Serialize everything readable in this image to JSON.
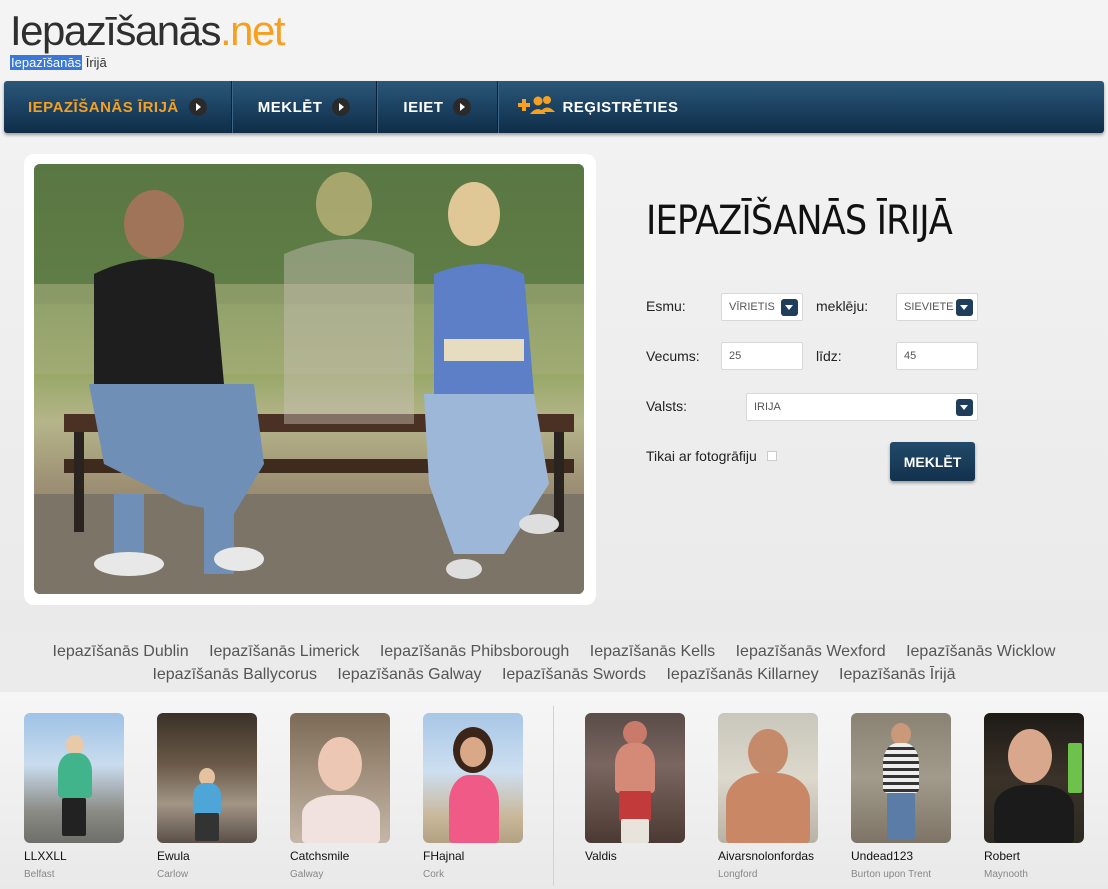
{
  "header": {
    "logo_brand": "Iepazīšanās",
    "logo_tld": ".net",
    "breadcrumb_selected": "Iepazīšanās",
    "breadcrumb_rest": " Īrijā"
  },
  "nav": {
    "items": [
      {
        "label": "IEPAZĪŠANĀS ĪRIJĀ",
        "icon": "chevron-right-icon"
      },
      {
        "label": "MEKLĒT",
        "icon": "chevron-right-icon"
      },
      {
        "label": "IEIET",
        "icon": "chevron-right-icon"
      },
      {
        "label": "REĢISTRĒTIES",
        "icon": "add-user-icon"
      }
    ],
    "accent": "#f5a021"
  },
  "search": {
    "title": "IEPAZĪŠANĀS ĪRIJĀ",
    "i_am_label": "Esmu:",
    "i_am_value": "VĪRIETIS",
    "seeking_label": "meklēju:",
    "seeking_value": "SIEVIETE",
    "age_label": "Vecums:",
    "age_from": "25",
    "to_label": "līdz:",
    "age_to": "45",
    "country_label": "Valsts:",
    "country_value": "IRIJA",
    "photo_only_label": "Tikai ar fotogrāfiju",
    "submit_label": "MEKLĒT",
    "button_color": "#12314d"
  },
  "city_links": {
    "row1": [
      "Iepazīšanās Dublin",
      "Iepazīšanās Limerick",
      "Iepazīšanās Phibsborough",
      "Iepazīšanās Kells",
      "Iepazīšanās Wexford",
      "Iepazīšanās Wicklow"
    ],
    "row2": [
      "Iepazīšanās Ballycorus",
      "Iepazīšanās Galway",
      "Iepazīšanās Swords",
      "Iepazīšanās Killarney",
      "Iepazīšanās Īrijā"
    ]
  },
  "profiles": [
    {
      "name": "LLXXLL",
      "city": "Belfast"
    },
    {
      "name": "Ewula",
      "city": "Carlow"
    },
    {
      "name": "Catchsmile",
      "city": "Galway"
    },
    {
      "name": "FHajnal",
      "city": "Cork"
    },
    {
      "name": "Valdis",
      "city": ""
    },
    {
      "name": "Aivarsnolonfordas",
      "city": "Longford"
    },
    {
      "name": "Undead123",
      "city": "Burton upon Trent"
    },
    {
      "name": "Robert",
      "city": "Maynooth"
    }
  ]
}
